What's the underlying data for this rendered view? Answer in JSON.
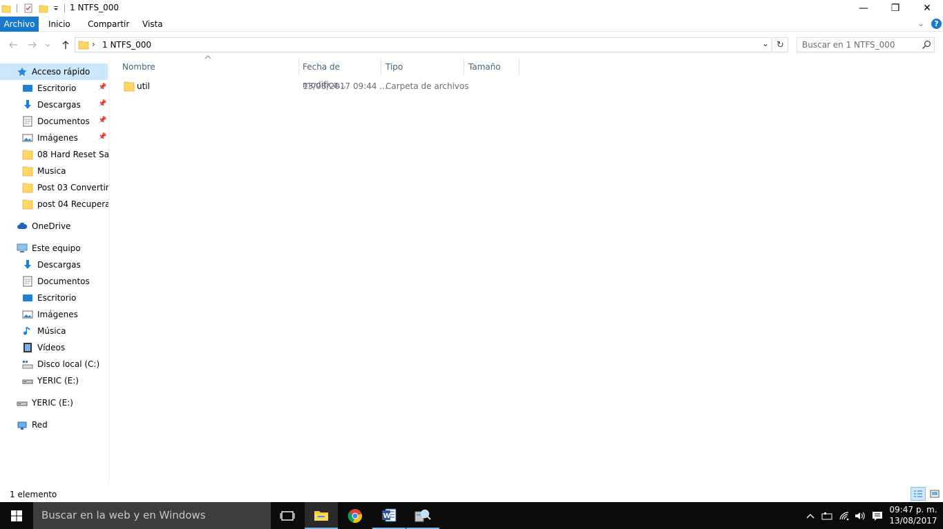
{
  "window": {
    "title": "1 NTFS_000",
    "minimize_glyph": "—",
    "restore_glyph": "❐",
    "close_glyph": "✕"
  },
  "ribbon": {
    "tabs": [
      "Archivo",
      "Inicio",
      "Compartir",
      "Vista"
    ],
    "expand_glyph": "⌄",
    "help_glyph": "?"
  },
  "address": {
    "separator": "›",
    "path": "1 NTFS_000",
    "dropdown_glyph": "⌄",
    "refresh_glyph": "↻"
  },
  "search": {
    "placeholder": "Buscar en 1 NTFS_000"
  },
  "nav": {
    "quick_access": "Acceso rápido",
    "quick_items": [
      {
        "label": "Escritorio",
        "icon": "desktop-icon",
        "pinned": true
      },
      {
        "label": "Descargas",
        "icon": "download-icon",
        "pinned": true
      },
      {
        "label": "Documentos",
        "icon": "documents-icon",
        "pinned": true
      },
      {
        "label": "Imágenes",
        "icon": "pictures-icon",
        "pinned": true
      },
      {
        "label": "08 Hard Reset Sams",
        "icon": "folder-icon",
        "pinned": false
      },
      {
        "label": "Musica",
        "icon": "folder-icon",
        "pinned": false
      },
      {
        "label": "Post 03 Convertir fo",
        "icon": "folder-icon",
        "pinned": false
      },
      {
        "label": "post 04 Recuperar d",
        "icon": "folder-icon",
        "pinned": false
      }
    ],
    "onedrive": "OneDrive",
    "this_pc": "Este equipo",
    "pc_items": [
      {
        "label": "Descargas",
        "icon": "download-icon"
      },
      {
        "label": "Documentos",
        "icon": "documents-icon"
      },
      {
        "label": "Escritorio",
        "icon": "desktop-icon"
      },
      {
        "label": "Imágenes",
        "icon": "pictures-icon"
      },
      {
        "label": "Música",
        "icon": "music-icon"
      },
      {
        "label": "Vídeos",
        "icon": "videos-icon"
      },
      {
        "label": "Disco local (C:)",
        "icon": "local-disk-icon"
      },
      {
        "label": "YERIC (E:)",
        "icon": "usb-drive-icon"
      }
    ],
    "usb_drive": "YERIC (E:)",
    "network": "Red"
  },
  "columns": [
    "Nombre",
    "Fecha de modifica...",
    "Tipo",
    "Tamaño"
  ],
  "files": [
    {
      "name": "util",
      "date": "13/08/2017 09:44 ...",
      "type": "Carpeta de archivos",
      "size": ""
    }
  ],
  "status": {
    "count": "1 elemento"
  },
  "taskbar": {
    "search_placeholder": "Buscar en la web y en Windows",
    "time": "09:47 p. m.",
    "date": "13/08/2017"
  },
  "colors": {
    "accent": "#1979ca",
    "selection": "#cce8ff",
    "folder": "#ffd864",
    "taskbar": "#0b0b0b"
  }
}
